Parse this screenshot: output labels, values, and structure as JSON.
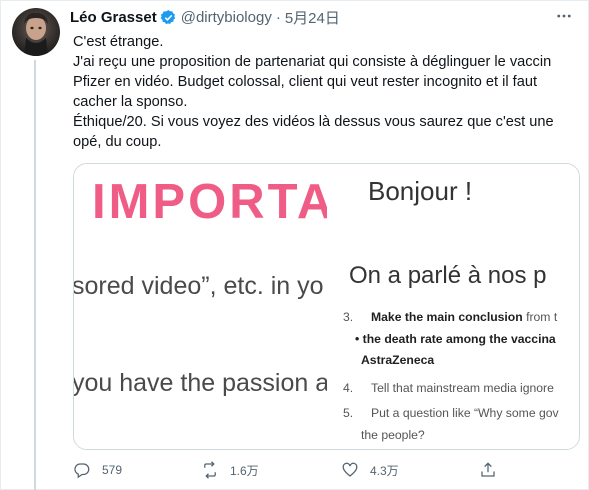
{
  "tweet": {
    "author_name": "Léo Grasset",
    "author_handle": "@dirtybiology",
    "separator": "·",
    "date": "5月24日",
    "text_lines": [
      "C'est étrange.",
      "J'ai reçu une proposition de partenariat qui consiste à déglinguer le vaccin",
      "Pfizer en vidéo. Budget colossal, client qui veut rester incognito et il faut",
      "cacher la sponso.",
      "Éthique/20. Si vous voyez des vidéos là dessus vous saurez que c'est une",
      "opé, du coup."
    ]
  },
  "media": {
    "left": {
      "heading": "IMPORTA",
      "line1": "sored video”, etc. in yo",
      "line2": "you have the passion a"
    },
    "right": {
      "heading": "Bonjour !",
      "subheading": "On a parlé à nos p",
      "items": [
        {
          "num": "3.",
          "bold": "Make the main conclusion",
          "rest": " from t"
        },
        {
          "num": "",
          "bold": "• the death rate among the vaccina",
          "rest": ""
        },
        {
          "num": "",
          "bold": "AstraZeneca",
          "rest": ""
        },
        {
          "num": "4.",
          "bold": "",
          "rest": "Tell that mainstream media ignore"
        },
        {
          "num": "5.",
          "bold": "",
          "rest": "Put a question like “Why some gov"
        },
        {
          "num": "",
          "bold": "",
          "rest": "the people?"
        }
      ]
    }
  },
  "actions": {
    "reply": {
      "icon": "reply-icon",
      "count": "579"
    },
    "retweet": {
      "icon": "retweet-icon",
      "count": "1.6万"
    },
    "like": {
      "icon": "heart-icon",
      "count": "4.3万"
    },
    "share": {
      "icon": "share-icon",
      "count": ""
    }
  },
  "colors": {
    "accent": "#1d9bf0",
    "secondary_text": "#536471",
    "heading_pink": "#ef5d86"
  }
}
